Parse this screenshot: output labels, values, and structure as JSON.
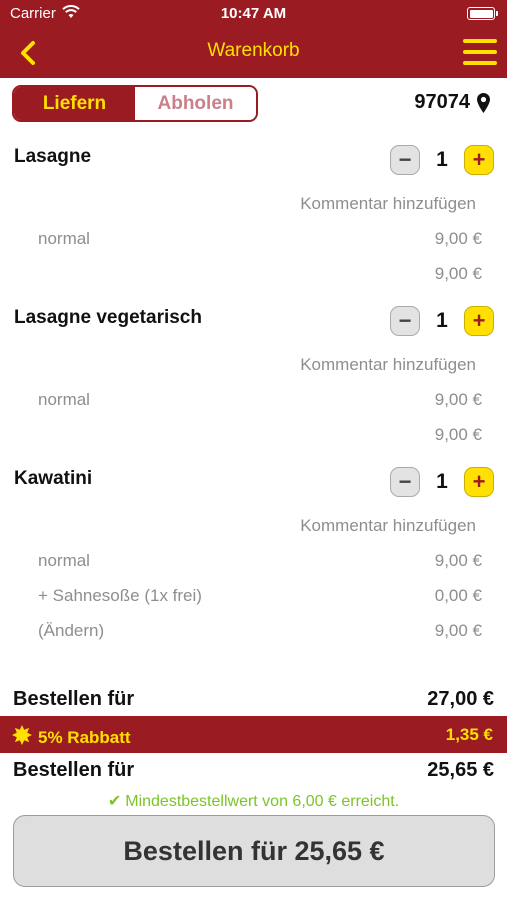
{
  "statusbar": {
    "carrier": "Carrier",
    "time": "10:47 AM"
  },
  "nav": {
    "title": "Warenkorb"
  },
  "mode": {
    "deliver": "Liefern",
    "pickup": "Abholen"
  },
  "postal_code": "97074",
  "items": [
    {
      "name": "Lasagne",
      "qty": "1",
      "comment": "Kommentar hinzufügen",
      "lines": [
        {
          "label": "normal",
          "price": "9,00 €"
        }
      ],
      "total": "9,00 €"
    },
    {
      "name": "Lasagne vegetarisch",
      "qty": "1",
      "comment": "Kommentar hinzufügen",
      "lines": [
        {
          "label": "normal",
          "price": "9,00 €"
        }
      ],
      "total": "9,00 €"
    },
    {
      "name": "Kawatini",
      "qty": "1",
      "comment": "Kommentar hinzufügen",
      "lines": [
        {
          "label": "normal",
          "price": "9,00 €"
        },
        {
          "label": "+ Sahnesoße (1x frei)",
          "price": "0,00 €"
        },
        {
          "label": "(Ändern)",
          "price": "9,00 €"
        }
      ]
    }
  ],
  "summary": {
    "subtotal_label": "Bestellen für",
    "subtotal_value": "27,00 €",
    "discount_label": "5% Rabbatt",
    "discount_value": "1,35 €",
    "total_label": "Bestellen für",
    "total_value": "25,65 €",
    "min_order_note": "Mindestbestellwert von 6,00 € erreicht."
  },
  "order_button": "Bestellen für 25,65 €",
  "colors": {
    "brand": "#9b1b22",
    "accent": "#ffe000",
    "success": "#7cc427"
  }
}
